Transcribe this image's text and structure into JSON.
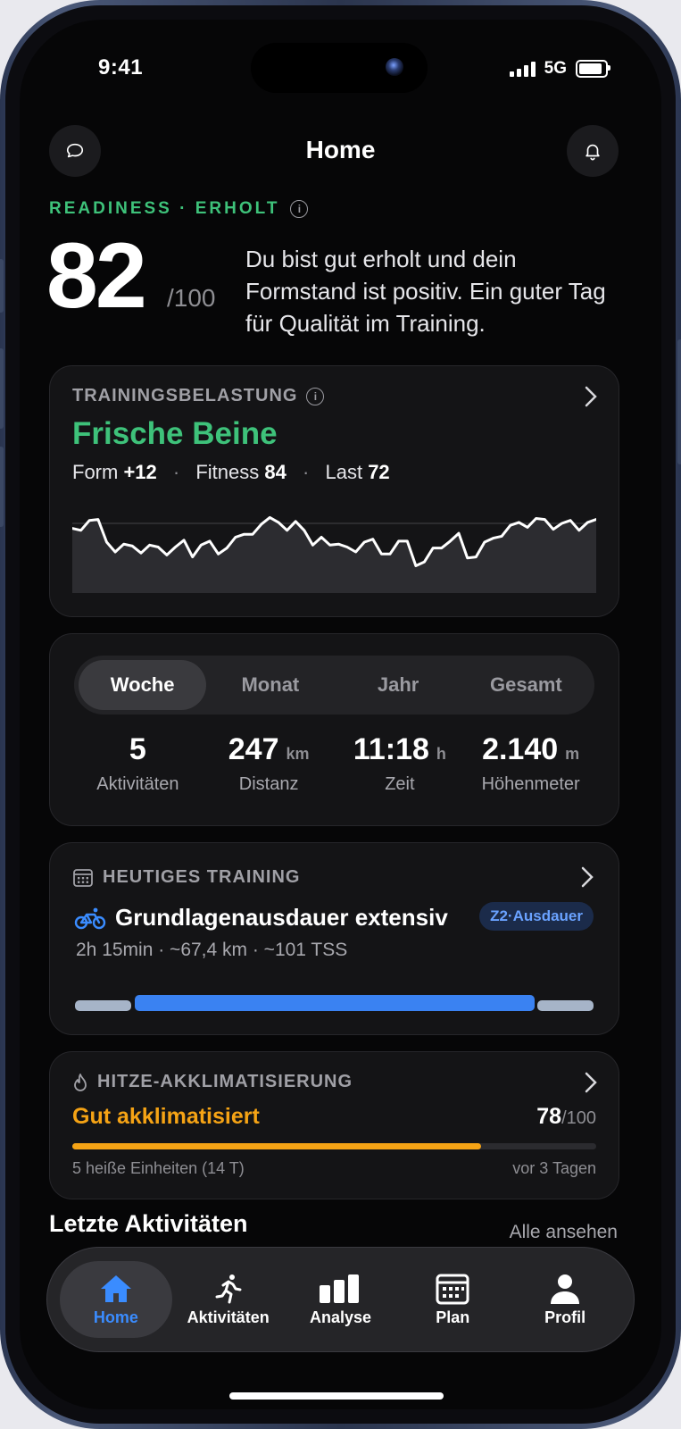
{
  "status": {
    "time": "9:41",
    "network": "5G"
  },
  "header": {
    "title": "Home",
    "left_icon": "chat-bubble-icon",
    "right_icon": "bell-icon"
  },
  "readiness": {
    "label": "READINESS · ERHOLT",
    "score": "82",
    "max": "/100",
    "description": "Du bist gut erholt und dein Formstand ist positiv. Ein guter Tag für Qualität im Training."
  },
  "training_load": {
    "label": "TRAININGSBELASTUNG",
    "status": "Frische Beine",
    "form_label": "Form",
    "form_value": "+12",
    "fitness_label": "Fitness",
    "fitness_value": "84",
    "load_label": "Last",
    "load_value": "72",
    "chart_values": [
      62,
      60,
      70,
      71,
      48,
      38,
      46,
      44,
      37,
      45,
      43,
      35,
      43,
      50,
      33,
      45,
      49,
      36,
      42,
      53,
      56,
      56,
      66,
      73,
      68,
      60,
      69,
      60,
      45,
      53,
      45,
      46,
      43,
      38,
      48,
      51,
      36,
      36,
      49,
      49,
      24,
      28,
      42,
      42,
      49,
      57,
      32,
      33,
      48,
      52,
      54,
      65,
      68,
      63,
      72,
      71,
      61,
      67,
      70,
      60,
      68,
      71
    ]
  },
  "summary": {
    "tabs": [
      "Woche",
      "Monat",
      "Jahr",
      "Gesamt"
    ],
    "active_tab": "Woche",
    "stats": [
      {
        "value": "5",
        "unit": "",
        "label": "Aktivitäten"
      },
      {
        "value": "247",
        "unit": "km",
        "label": "Distanz"
      },
      {
        "value": "11:18",
        "unit": "h",
        "label": "Zeit"
      },
      {
        "value": "2.140",
        "unit": "m",
        "label": "Höhenmeter"
      }
    ]
  },
  "today": {
    "label": "HEUTIGES TRAINING",
    "name": "Grundlagenausdauer extensiv",
    "badge": "Z2·Ausdauer",
    "meta": "2h 15min · ~67,4 km · ~101 TSS",
    "segment_colors": {
      "warmup": "#a6b4c8",
      "main": "#3a82f2",
      "cooldown": "#a6b4c8"
    }
  },
  "heat": {
    "label": "HITZE-AKKLIMATISIERUNG",
    "status": "Gut akklimatisiert",
    "score": "78",
    "max": "/100",
    "progress": 0.78,
    "units": "5 heiße Einheiten (14 T)",
    "ago": "vor 3 Tagen"
  },
  "recent": {
    "title": "Letzte Aktivitäten",
    "see_all": "Alle ansehen"
  },
  "tabbar": [
    {
      "label": "Home",
      "icon": "home-icon",
      "active": true
    },
    {
      "label": "Aktivitäten",
      "icon": "runner-icon",
      "active": false
    },
    {
      "label": "Analyse",
      "icon": "bar-chart-icon",
      "active": false
    },
    {
      "label": "Plan",
      "icon": "calendar-icon",
      "active": false
    },
    {
      "label": "Profil",
      "icon": "person-icon",
      "active": false
    }
  ],
  "colors": {
    "accent_green": "#3ec27a",
    "accent_orange": "#f5a315",
    "accent_blue": "#3a8cff"
  }
}
